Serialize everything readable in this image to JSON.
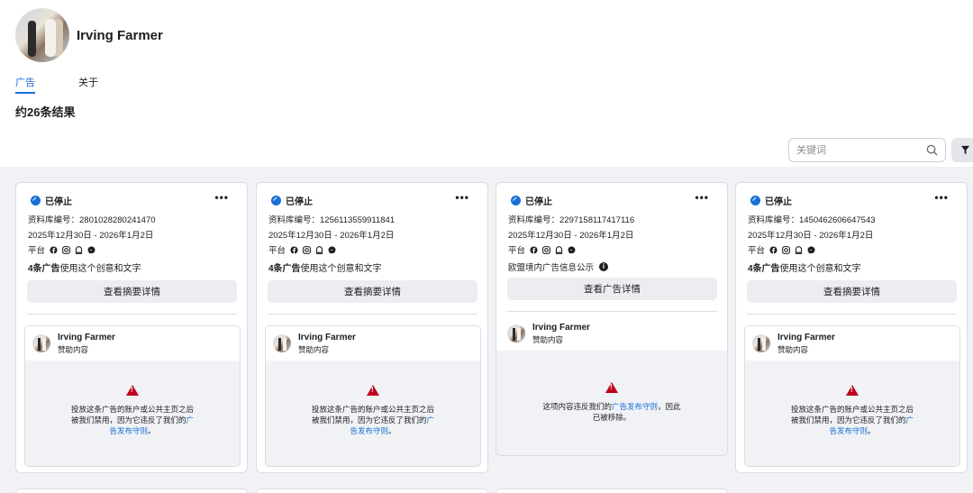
{
  "page": {
    "name": "Irving Farmer"
  },
  "tabs": [
    {
      "label": "广告"
    },
    {
      "label": "关于"
    }
  ],
  "results_label": "约26条结果",
  "search": {
    "placeholder": "关键词"
  },
  "cards": [
    {
      "status": "已停止",
      "library_id": "资料库编号：2801028280241470",
      "dates": "2025年12月30日 - 2026年1月2日",
      "platform_label": "平台",
      "info_bold": "4条广告",
      "info_rest": "使用这个创意和文字",
      "button": "查看摘要详情",
      "advertiser": "Irving Farmer",
      "sponsored": "赞助内容",
      "warn_pre": "投放这条广告的账户或公共主页之后被我们禁用，因为它违反了我们的",
      "warn_link": "广告发布守则",
      "warn_post": "。"
    },
    {
      "status": "已停止",
      "library_id": "资料库编号：1256113559911841",
      "dates": "2025年12月30日 - 2026年1月2日",
      "platform_label": "平台",
      "info_bold": "4条广告",
      "info_rest": "使用这个创意和文字",
      "button": "查看摘要详情",
      "advertiser": "Irving Farmer",
      "sponsored": "赞助内容",
      "warn_pre": "投放这条广告的账户或公共主页之后被我们禁用，因为它违反了我们的",
      "warn_link": "广告发布守则",
      "warn_post": "。"
    },
    {
      "status": "已停止",
      "library_id": "资料库编号：2297158117417116",
      "dates": "2025年12月30日 - 2026年1月2日",
      "platform_label": "平台",
      "info_bold": "",
      "info_rest": "欧盟境内广告信息公示",
      "button": "查看广告详情",
      "advertiser": "Irving Farmer",
      "sponsored": "赞助内容",
      "warn_pre": "这项内容违反我们的",
      "warn_link": "广告发布守则",
      "warn_post": "，因此已被移除。"
    },
    {
      "status": "已停止",
      "library_id": "资料库编号：1450462606647543",
      "dates": "2025年12月30日 - 2026年1月2日",
      "platform_label": "平台",
      "info_bold": "4条广告",
      "info_rest": "使用这个创意和文字",
      "button": "查看摘要详情",
      "advertiser": "Irving Farmer",
      "sponsored": "赞助内容",
      "warn_pre": "投放这条广告的账户或公共主页之后被我们禁用，因为它违反了我们的",
      "warn_link": "广告发布守则",
      "warn_post": "。"
    }
  ],
  "colors": {
    "accent": "#1a6ed8",
    "warning": "#c0001a",
    "background": "#f0f2f5"
  }
}
